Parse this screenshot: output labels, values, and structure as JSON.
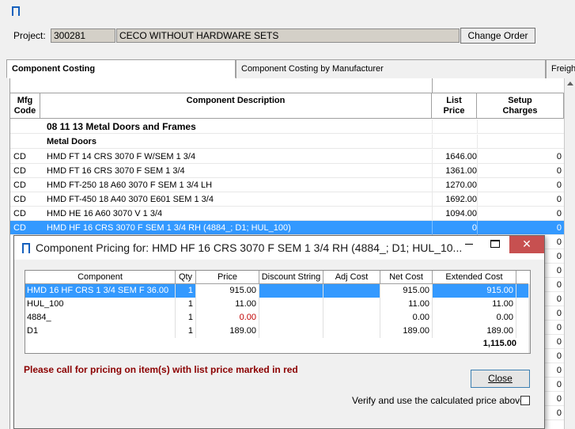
{
  "project": {
    "label": "Project:",
    "number": "300281",
    "name": "CECO WITHOUT HARDWARE SETS",
    "change_order_label": "Change Order"
  },
  "tabs": [
    {
      "label": "Component Costing"
    },
    {
      "label": "Component Costing by Manufacturer"
    },
    {
      "label": "Freight-I"
    }
  ],
  "grid": {
    "headers": {
      "mfg_line1": "Mfg",
      "mfg_line2": "Code",
      "desc": "Component Description",
      "list_line1": "List",
      "list_line2": "Price",
      "setup_line1": "Setup",
      "setup_line2": "Charges"
    },
    "section": "08 11 13 Metal Doors and Frames",
    "subsection": "Metal Doors",
    "rows": [
      {
        "mfg": "CD",
        "desc": "HMD FT 14 CRS 3070 F W/SEM 1 3/4",
        "list": "1646.00",
        "setup": "0"
      },
      {
        "mfg": "CD",
        "desc": "HMD FT 16 CRS 3070 F SEM 1 3/4",
        "list": "1361.00",
        "setup": "0"
      },
      {
        "mfg": "CD",
        "desc": "HMD FT-250 18 A60 3070 F SEM 1 3/4 LH",
        "list": "1270.00",
        "setup": "0"
      },
      {
        "mfg": "CD",
        "desc": "HMD FT-450 18 A40 3070 E601 SEM 1 3/4",
        "list": "1692.00",
        "setup": "0"
      },
      {
        "mfg": "CD",
        "desc": "HMD HE 16 A60 3070 V 1 3/4",
        "list": "1094.00",
        "setup": "0"
      },
      {
        "mfg": "CD",
        "desc": "HMD HF 16 CRS 3070 F SEM 1 3/4 RH (4884_; D1; HUL_100)",
        "list": "0",
        "setup": "0"
      }
    ],
    "extra_setup_values": [
      "0",
      "0",
      "0",
      "0",
      "0",
      "0",
      "0",
      "0",
      "0",
      "0",
      "0",
      "0",
      "0"
    ]
  },
  "dialog": {
    "title": "Component Pricing for: HMD HF 16 CRS 3070 F SEM 1 3/4 RH (4884_; D1; HUL_10...",
    "close_x": "✕",
    "headers": {
      "component": "Component",
      "qty": "Qty",
      "price": "Price",
      "discount": "Discount String",
      "adj": "Adj Cost",
      "net": "Net Cost",
      "extended": "Extended Cost"
    },
    "rows": [
      {
        "component": "HMD 16 HF CRS 1 3/4  SEM F   36.00",
        "qty": "1",
        "price": "915.00",
        "discount": "",
        "adj": "",
        "net": "915.00",
        "extended": "915.00"
      },
      {
        "component": "HUL_100",
        "qty": "1",
        "price": "11.00",
        "discount": "",
        "adj": "",
        "net": "11.00",
        "extended": "11.00"
      },
      {
        "component": "4884_",
        "qty": "1",
        "price": "0.00",
        "discount": "",
        "adj": "",
        "net": "0.00",
        "extended": "0.00"
      },
      {
        "component": "D1",
        "qty": "1",
        "price": "189.00",
        "discount": "",
        "adj": "",
        "net": "189.00",
        "extended": "189.00"
      }
    ],
    "total": "1,115.00",
    "red_message": "Please call for pricing on item(s) with list price marked in red",
    "close_label": "Close",
    "verify_label": "Verify and use the calculated price above",
    "verify_checked": false
  },
  "colors": {
    "selection": "#3399ff",
    "red_price": "#c00000",
    "message": "#8b0000",
    "close_button_bg": "#c75050"
  }
}
